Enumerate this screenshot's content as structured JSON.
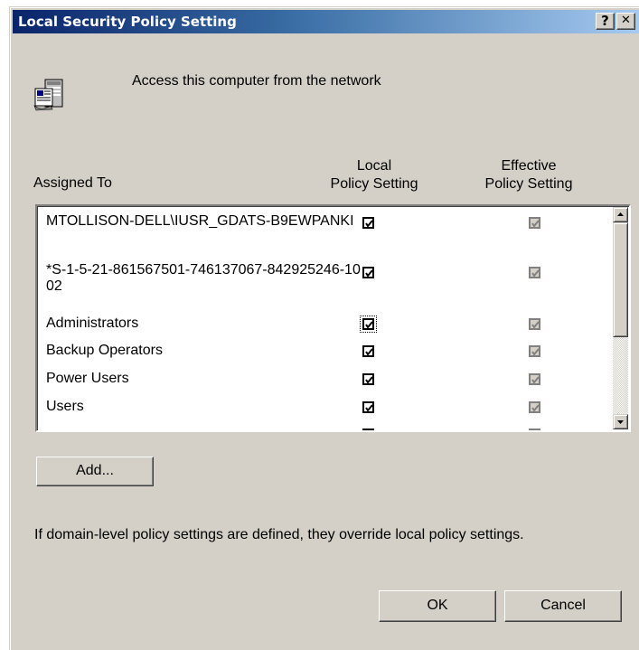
{
  "window": {
    "title": "Local Security Policy Setting",
    "help_button": "?",
    "close_button": "✕"
  },
  "policy": {
    "name": "Access this computer from the network",
    "icon": "policy-server-icon"
  },
  "columns": {
    "assigned_to": "Assigned To",
    "local_line1": "Local",
    "local_line2": "Policy Setting",
    "effective_line1": "Effective",
    "effective_line2": "Policy Setting"
  },
  "rows": [
    {
      "label": "MTOLLISON-DELL\\IUSR_GDATS-B9EWPANKI",
      "local": true,
      "effective": true,
      "focused": false
    },
    {
      "label": "*S-1-5-21-861567501-746137067-842925246-1002",
      "local": true,
      "effective": true,
      "focused": false
    },
    {
      "label": "Administrators",
      "local": true,
      "effective": true,
      "focused": true
    },
    {
      "label": "Backup Operators",
      "local": true,
      "effective": true,
      "focused": false
    },
    {
      "label": "Power Users",
      "local": true,
      "effective": true,
      "focused": false
    },
    {
      "label": "Users",
      "local": true,
      "effective": true,
      "focused": false
    },
    {
      "label": "",
      "local": true,
      "effective": true,
      "focused": false
    }
  ],
  "buttons": {
    "add": "Add...",
    "ok": "OK",
    "cancel": "Cancel"
  },
  "note": "If domain-level policy settings are defined, they override local policy settings.",
  "colors": {
    "title_start": "#0a246a",
    "title_end": "#a6caf0",
    "face": "#d4d0c8"
  }
}
